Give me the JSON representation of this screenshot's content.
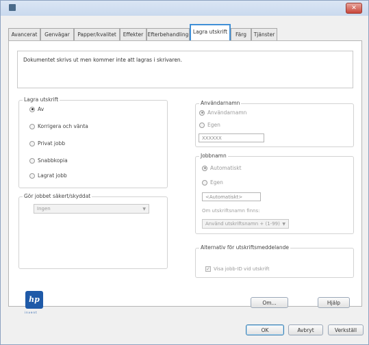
{
  "window": {
    "close_label": "✕"
  },
  "tabs": [
    {
      "label": "Avancerat",
      "active": false
    },
    {
      "label": "Genvägar",
      "active": false
    },
    {
      "label": "Papper/kvalitet",
      "active": false
    },
    {
      "label": "Effekter",
      "active": false
    },
    {
      "label": "Efterbehandling",
      "active": false
    },
    {
      "label": "Lagra utskrift",
      "active": true
    },
    {
      "label": "Färg",
      "active": false
    },
    {
      "label": "Tjänster",
      "active": false
    }
  ],
  "info_text": "Dokumentet skrivs ut men kommer inte att lagras i skrivaren.",
  "store_mode": {
    "legend": "Lagra utskrift",
    "options": [
      {
        "label": "Av",
        "selected": true
      },
      {
        "label": "Korrigera och vänta",
        "selected": false
      },
      {
        "label": "Privat jobb",
        "selected": false
      },
      {
        "label": "Snabbkopia",
        "selected": false
      },
      {
        "label": "Lagrat jobb",
        "selected": false
      }
    ]
  },
  "secure": {
    "legend": "Gör jobbet säkert/skyddat",
    "value": "Ingen"
  },
  "username": {
    "legend": "Användarnamn",
    "options": [
      {
        "label": "Användarnamn",
        "selected": true
      },
      {
        "label": "Egen",
        "selected": false
      }
    ],
    "value": "XXXXXX"
  },
  "jobname": {
    "legend": "Jobbnamn",
    "options": [
      {
        "label": "Automatiskt",
        "selected": true
      },
      {
        "label": "Egen",
        "selected": false
      }
    ],
    "value": "<Automatiskt>",
    "exists_label": "Om utskriftsnamn finns:",
    "exists_value": "Använd utskriftsnamn + (1-99)"
  },
  "notification": {
    "legend": "Alternativ för utskriftsmeddelande",
    "checkbox_label": "Visa jobb-ID vid utskrift",
    "checked": true
  },
  "brand": {
    "logo_text": "hp",
    "tagline": "invent"
  },
  "buttons": {
    "about": "Om...",
    "help": "Hjälp",
    "ok": "OK",
    "cancel": "Avbryt",
    "apply": "Verkställ"
  }
}
